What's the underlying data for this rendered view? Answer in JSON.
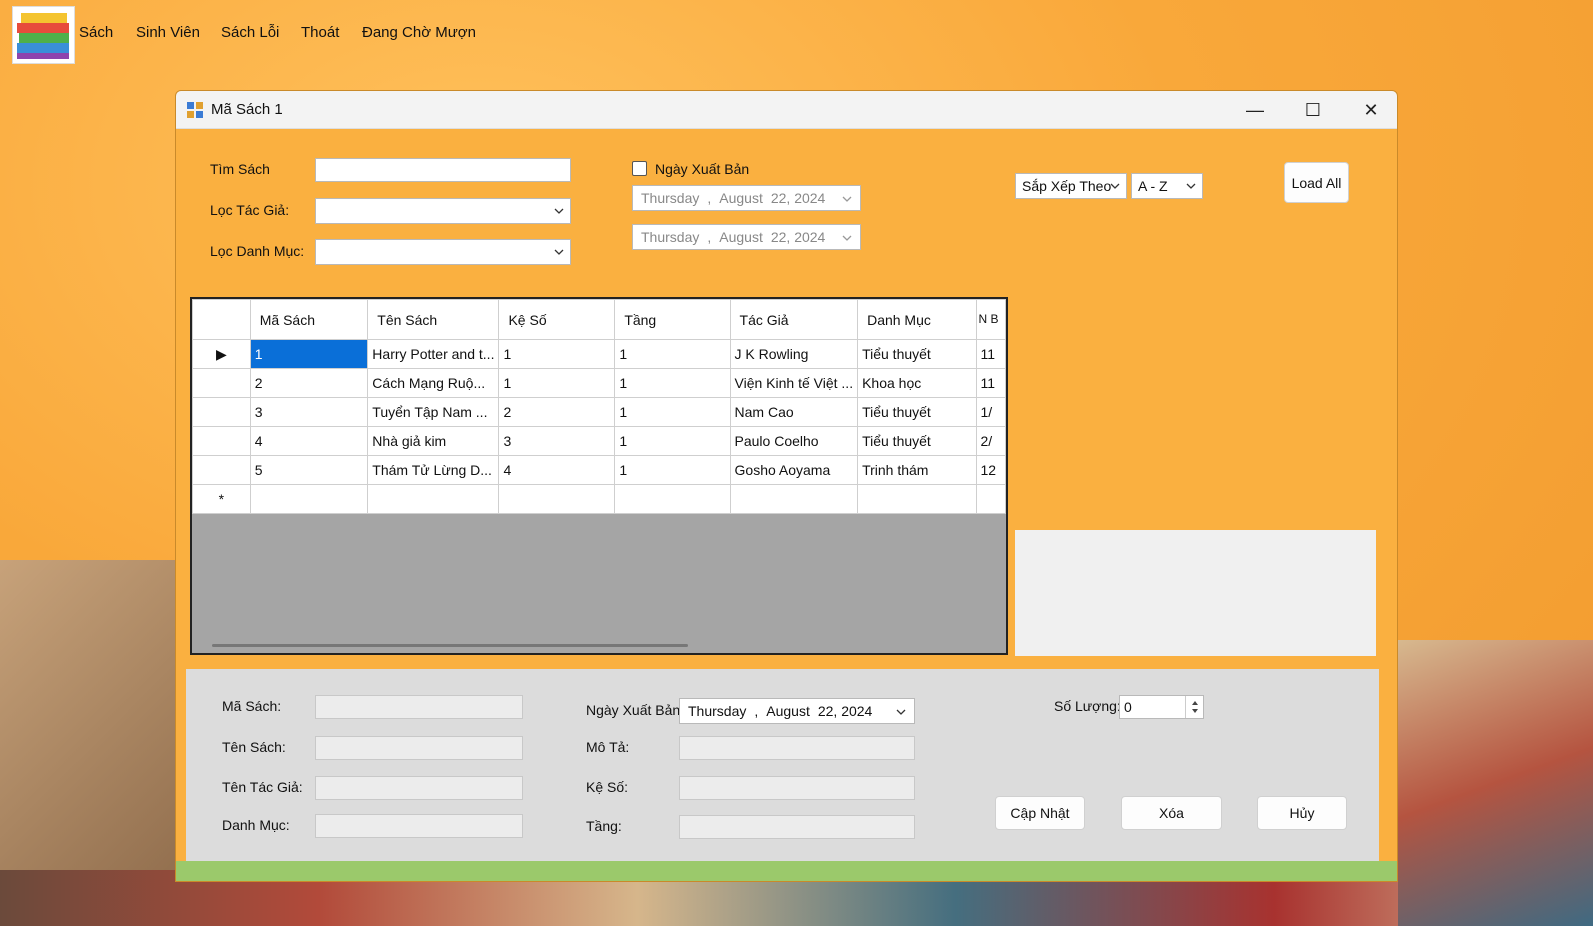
{
  "menubar": {
    "items": [
      "Sách",
      "Sinh Viên",
      "Sách Lỗi",
      "Thoát",
      "Đang Chờ Mượn"
    ]
  },
  "window": {
    "title": "Mã Sách 1",
    "minimize_glyph": "—",
    "maximize_glyph": "☐",
    "close_glyph": "✕"
  },
  "filters": {
    "search_label": "Tìm Sách",
    "search_value": "",
    "author_label": "Lọc Tác Giả:",
    "author_value": "",
    "category_label": "Lọc Danh Mục:",
    "category_value": "",
    "publish_date_label": "Ngày Xuất Bản",
    "publish_date_checked": false,
    "date_from": {
      "weekday": "Thursday",
      "sep": ",",
      "month": "August",
      "day_year": "22, 2024"
    },
    "date_to": {
      "weekday": "Thursday",
      "sep": ",",
      "month": "August",
      "day_year": "22, 2024"
    },
    "sort_label": "Sắp Xếp Theo",
    "sort_order": "A - Z",
    "load_all_label": "Load All"
  },
  "grid": {
    "columns": [
      "",
      "Mã Sách",
      "Tên Sách",
      "Kệ Số",
      "Tầng",
      "Tác Giả",
      "Danh Mục",
      "N B"
    ],
    "rows": [
      {
        "marker": "▶",
        "cells": [
          "1",
          "Harry Potter and t...",
          "1",
          "1",
          "J K Rowling",
          "Tiểu thuyết",
          "11"
        ]
      },
      {
        "marker": "",
        "cells": [
          "2",
          "Cách Mạng Ruộ...",
          "1",
          "1",
          "Viện Kinh tế Việt ...",
          "Khoa học",
          "11"
        ]
      },
      {
        "marker": "",
        "cells": [
          "3",
          "Tuyển Tập Nam ...",
          "2",
          "1",
          "Nam Cao",
          "Tiểu thuyết",
          "1/"
        ]
      },
      {
        "marker": "",
        "cells": [
          "4",
          "Nhà giả kim",
          "3",
          "1",
          "Paulo Coelho",
          "Tiểu thuyết",
          "2/"
        ]
      },
      {
        "marker": "",
        "cells": [
          "5",
          "Thám Tử Lừng D...",
          "4",
          "1",
          "Gosho Aoyama",
          "Trinh thám",
          "12"
        ]
      },
      {
        "marker": "*",
        "cells": [
          "",
          "",
          "",
          "",
          "",
          "",
          ""
        ]
      }
    ]
  },
  "details": {
    "ma_sach_label": "Mã Sách:",
    "ten_sach_label": "Tên Sách:",
    "ten_tac_gia_label": "Tên Tác Giả:",
    "danh_muc_label": "Danh Mục:",
    "ngay_xuat_ban_label": "Ngày Xuất Bản:",
    "publish_date": {
      "weekday": "Thursday",
      "sep": ",",
      "month": "August",
      "day_year": "22, 2024"
    },
    "mo_ta_label": "Mô Tả:",
    "ke_so_label": "Kệ Số:",
    "tang_label": "Tầng:",
    "so_luong_label": "Số Lượng:",
    "so_luong_value": "0",
    "update_label": "Cập Nhật",
    "delete_label": "Xóa",
    "cancel_label": "Hủy"
  },
  "colors": {
    "background": "#f9a83a",
    "selected_cell": "#0a6fd8",
    "grid_empty": "#a5a5a5"
  }
}
